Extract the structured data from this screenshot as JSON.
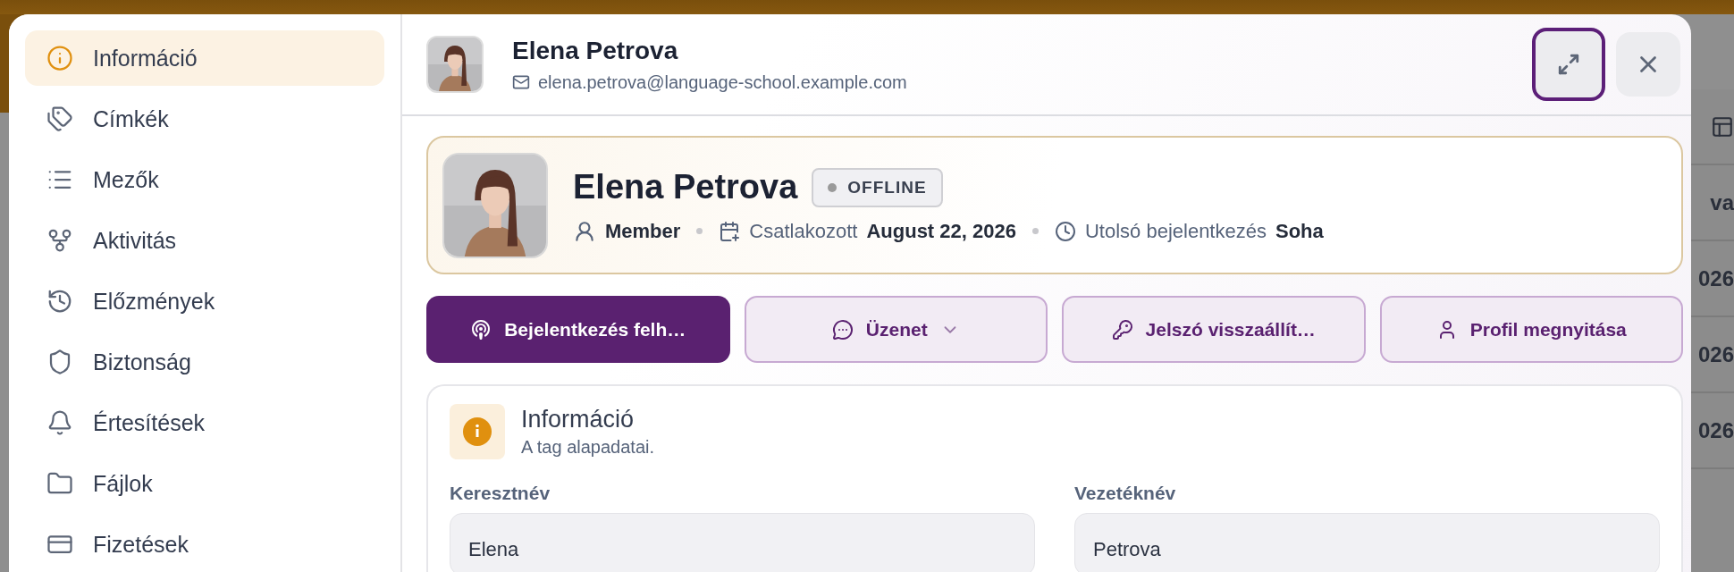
{
  "sidebar": {
    "items": [
      {
        "label": "Információ",
        "selected": true
      },
      {
        "label": "Címkék",
        "selected": false
      },
      {
        "label": "Mezők",
        "selected": false
      },
      {
        "label": "Aktivitás",
        "selected": false
      },
      {
        "label": "Előzmények",
        "selected": false
      },
      {
        "label": "Biztonság",
        "selected": false
      },
      {
        "label": "Értesítések",
        "selected": false
      },
      {
        "label": "Fájlok",
        "selected": false
      },
      {
        "label": "Fizetések",
        "selected": false
      }
    ]
  },
  "header": {
    "name": "Elena Petrova",
    "email": "elena.petrova@language-school.example.com",
    "expand_button": {
      "focused": true
    }
  },
  "profile": {
    "name": "Elena Petrova",
    "status": "OFFLINE",
    "role": "Member",
    "joined_label": "Csatlakozott",
    "joined_value": "August 22, 2026",
    "last_login_label": "Utolsó bejelentkezés",
    "last_login_value": "Soha"
  },
  "actions": [
    {
      "label": "Bejelentkezés felh…",
      "kind": "primary",
      "dropdown": false
    },
    {
      "label": "Üzenet",
      "kind": "secondary",
      "dropdown": true
    },
    {
      "label": "Jelszó visszaállít…",
      "kind": "secondary",
      "dropdown": false
    },
    {
      "label": "Profil megnyitása",
      "kind": "secondary",
      "dropdown": false
    }
  ],
  "info_section": {
    "title": "Információ",
    "subtitle": "A tag alapadatai.",
    "fields": [
      {
        "label": "Keresztnév",
        "value": "Elena"
      },
      {
        "label": "Vezetéknév",
        "value": "Petrova"
      }
    ]
  },
  "background_table": {
    "cells": [
      "va",
      "026",
      "026",
      "026"
    ]
  }
}
